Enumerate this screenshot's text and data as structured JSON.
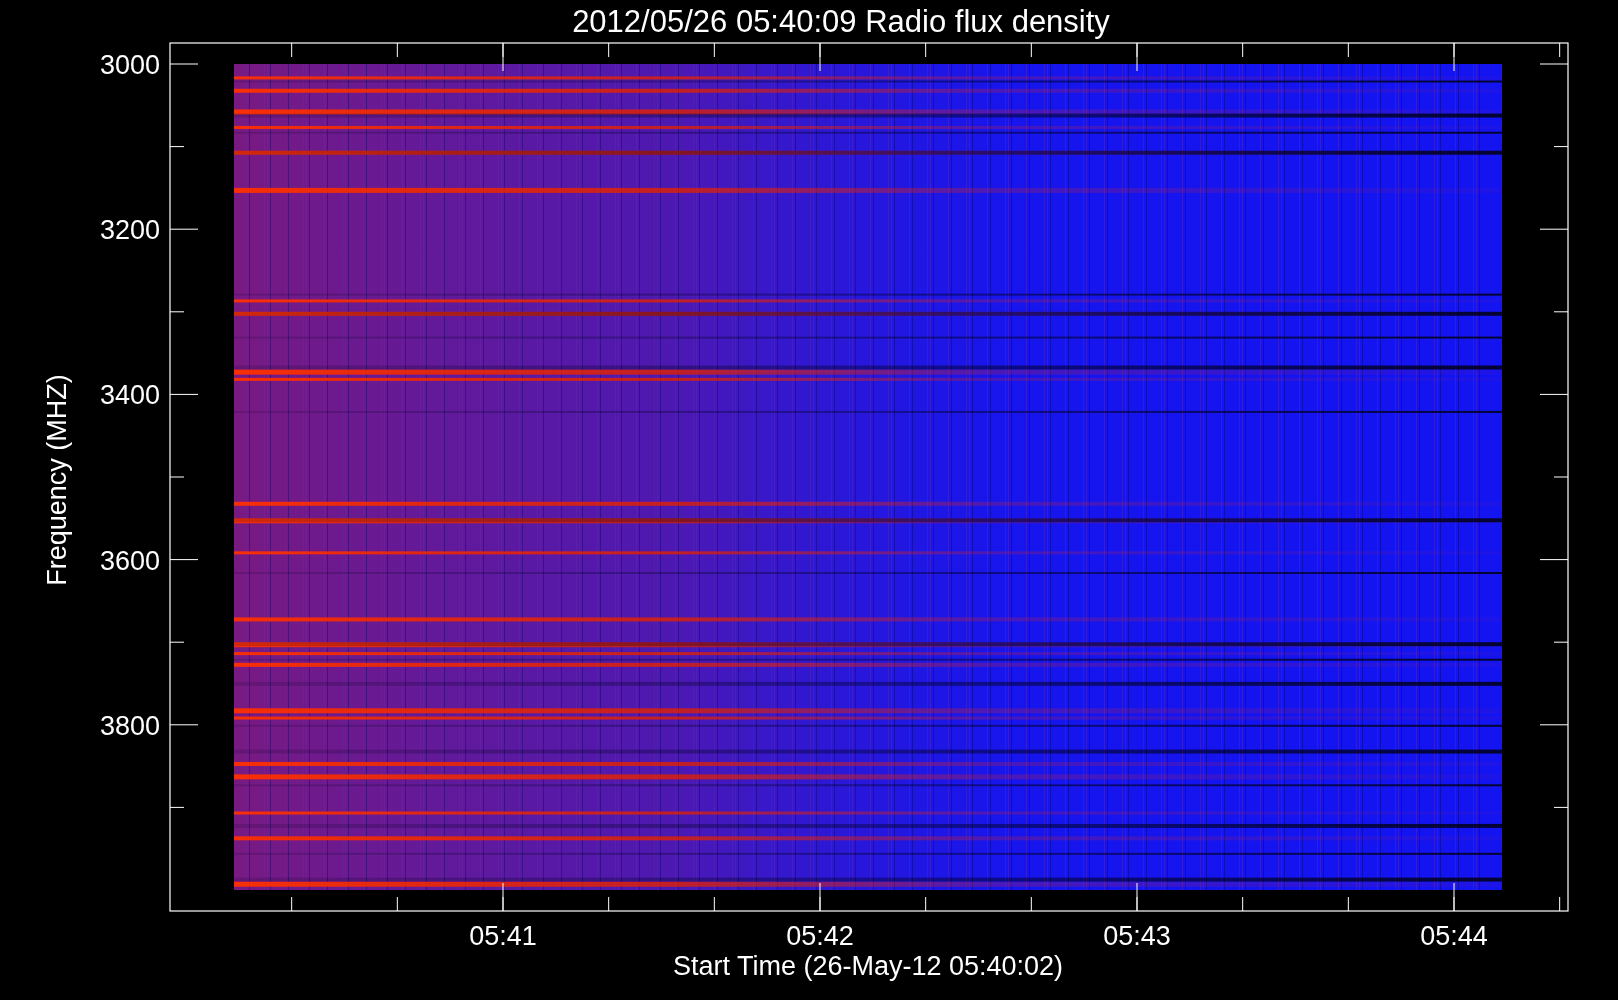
{
  "plot": {
    "title": "2012/05/26 05:40:09 Radio flux density",
    "xlabel": "Start Time (26-May-12 05:40:02)",
    "ylabel": "Frequency (MHZ)",
    "xticks": [
      "05:41",
      "05:42",
      "05:43",
      "05:44"
    ],
    "yticks": [
      "3000",
      "3200",
      "3400",
      "3600",
      "3800"
    ]
  }
}
